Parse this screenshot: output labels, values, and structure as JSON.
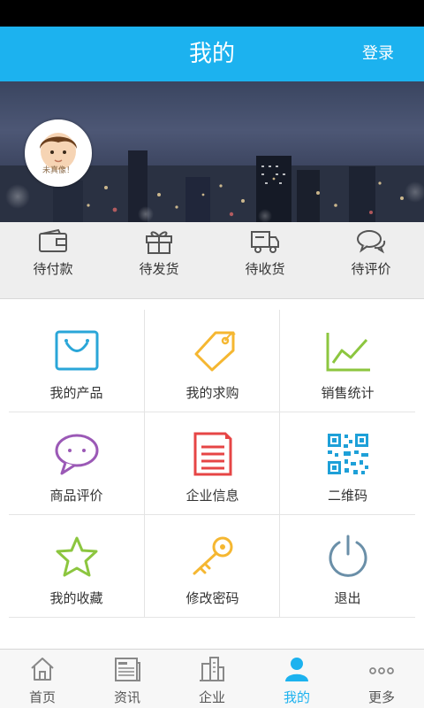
{
  "header": {
    "title": "我的",
    "login_label": "登录"
  },
  "profile": {
    "avatar_hint": "未真像！"
  },
  "orders": [
    {
      "label": "待付款",
      "icon": "wallet-icon"
    },
    {
      "label": "待发货",
      "icon": "gift-icon"
    },
    {
      "label": "待收货",
      "icon": "truck-icon"
    },
    {
      "label": "待评价",
      "icon": "chat-bubbles-icon"
    }
  ],
  "grid": [
    {
      "label": "我的产品",
      "icon": "shopping-bag-icon",
      "color": "#2aa6d8"
    },
    {
      "label": "我的求购",
      "icon": "tag-icon",
      "color": "#f5b731"
    },
    {
      "label": "销售统计",
      "icon": "line-chart-icon",
      "color": "#8cc63f"
    },
    {
      "label": "商品评价",
      "icon": "speech-bubble-icon",
      "color": "#9b59b6"
    },
    {
      "label": "企业信息",
      "icon": "document-icon",
      "color": "#e64545"
    },
    {
      "label": "二维码",
      "icon": "qr-code-icon",
      "color": "#1ea0d8"
    },
    {
      "label": "我的收藏",
      "icon": "star-icon",
      "color": "#8cc63f"
    },
    {
      "label": "修改密码",
      "icon": "key-icon",
      "color": "#f5b731"
    },
    {
      "label": "退出",
      "icon": "power-icon",
      "color": "#6a8fa8"
    }
  ],
  "tabs": [
    {
      "label": "首页",
      "icon": "home-icon"
    },
    {
      "label": "资讯",
      "icon": "newspaper-icon"
    },
    {
      "label": "企业",
      "icon": "buildings-icon"
    },
    {
      "label": "我的",
      "icon": "user-icon",
      "active": true
    },
    {
      "label": "更多",
      "icon": "more-dots-icon"
    }
  ],
  "colors": {
    "accent": "#1cb2ef",
    "tab_active": "#1cb2ef",
    "order_bar_bg": "#eeeeee"
  }
}
